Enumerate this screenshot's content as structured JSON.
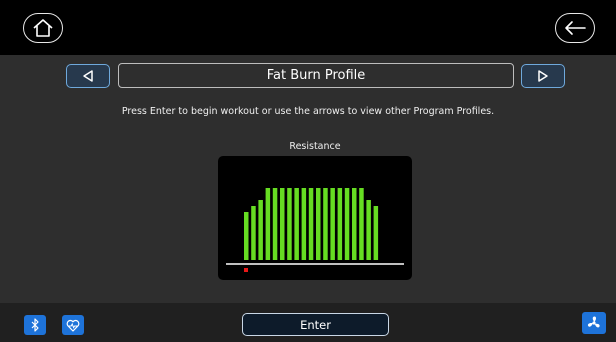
{
  "header": {
    "home_icon": "home-icon",
    "back_icon": "back-arrow-icon"
  },
  "program": {
    "title": "Fat Burn Profile",
    "prev_icon": "triangle-left-icon",
    "next_icon": "triangle-right-icon",
    "instruction": "Press Enter to begin workout or use the arrows to view other Program Profiles."
  },
  "resistance_chart": {
    "label": "Resistance",
    "bar_color": "#66dd22",
    "current_marker_color": "#e81818",
    "current_segment_index": 0
  },
  "chart_data": {
    "type": "bar",
    "title": "Resistance",
    "values": [
      8,
      9,
      10,
      12,
      12,
      12,
      12,
      12,
      12,
      12,
      12,
      12,
      12,
      12,
      12,
      12,
      12,
      10,
      9
    ],
    "ylim": [
      0,
      12.5
    ]
  },
  "footer": {
    "enter_label": "Enter",
    "bluetooth_icon": "bluetooth-icon",
    "heart_icon": "heart-icon",
    "fan_icon": "fan-icon"
  },
  "colors": {
    "accent": "#1e73d9",
    "button_border": "#6fa9dc",
    "background": "#2e2e2e"
  }
}
